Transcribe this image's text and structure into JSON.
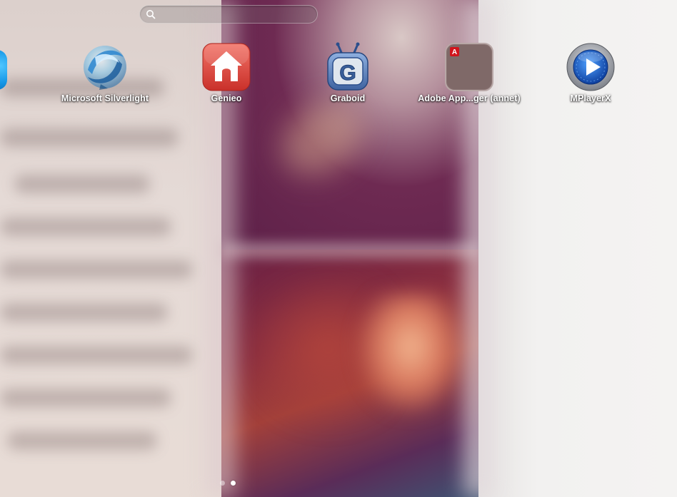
{
  "search": {
    "value": "",
    "placeholder": ""
  },
  "apps": [
    {
      "label": "Microsoft Silverlight",
      "icon": "silverlight-icon"
    },
    {
      "label": "Genieo",
      "icon": "genieo-house-icon"
    },
    {
      "label": "Graboid",
      "icon": "graboid-tv-icon"
    },
    {
      "label": "Adobe App...ger (annet)",
      "icon": "adobe-folder-icon"
    },
    {
      "label": "MPlayerX",
      "icon": "mplayerx-play-icon"
    }
  ],
  "partial_app": {
    "icon": "partial-app-icon"
  },
  "pages": {
    "count": 2,
    "current": 2
  },
  "colors": {
    "genieo_red": "#e5463f",
    "graboid_blue": "#4a6fa8",
    "mplayer_blue": "#1a5fc8",
    "adobe_red": "#d1141c"
  }
}
